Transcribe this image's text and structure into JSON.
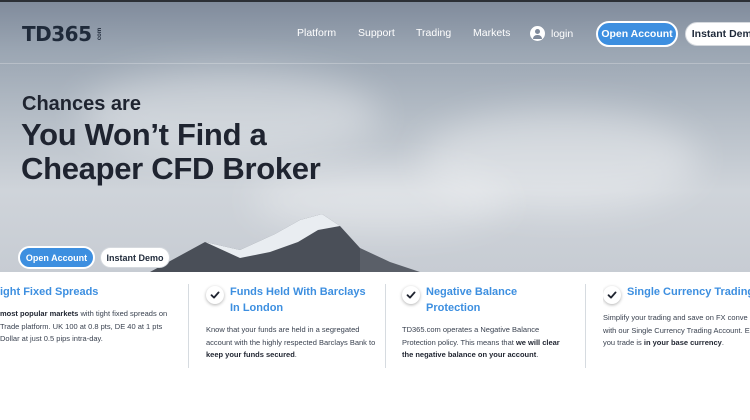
{
  "header": {
    "logo": "TD365",
    "logo_badge": "com",
    "nav": [
      "Platform",
      "Support",
      "Trading",
      "Markets"
    ],
    "login": "login",
    "open_account": "Open Account",
    "instant_demo": "Instant Demo"
  },
  "hero": {
    "subtitle": "Chances are",
    "title": "You Won’t Find a Cheaper CFD Broker",
    "open_account": "Open Account",
    "instant_demo": "Instant Demo"
  },
  "features": [
    {
      "title": "ight Fixed Spreads",
      "text_1": "",
      "bold_1": "most popular markets",
      "text_2": " with tight fixed spreads on",
      "text_3": "Trade platform. UK 100 at 0.8 pts, DE 40 at 1 pts",
      "text_4": "Dollar at just 0.5 pips intra-day."
    },
    {
      "title": "Funds Held With Barclays In London",
      "text_1": "Know that your funds are held in a segregated account with the highly respected Barclays Bank to ",
      "bold_1": "keep your funds secured",
      "text_2": "."
    },
    {
      "title": "Negative Balance Protection",
      "text_1": "TD365.com operates a Negative Balance Protection policy. This means that ",
      "bold_1": "we will clear the negative balance on your account",
      "text_2": "."
    },
    {
      "title": "Single Currency Trading",
      "text_1": "Simplify your trading and save on FX conve",
      "text_2": "with our Single Currency Trading Account. E",
      "text_3": "you trade is ",
      "bold_1": "in your base currency",
      "text_4": "."
    }
  ],
  "colors": {
    "accent": "#3d8fe0",
    "heading": "#1f2430"
  }
}
